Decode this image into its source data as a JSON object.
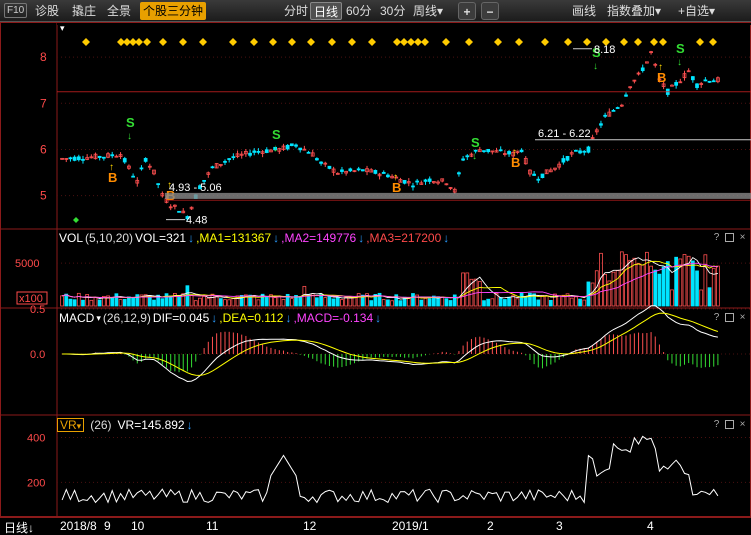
{
  "toolbar": {
    "f10": "F10",
    "diagnose": "诊股",
    "pick": "撬庄",
    "panorama": "全景",
    "minute3": "个股三分钟",
    "intraday": "分时",
    "daily": "日线",
    "m60": "60分",
    "m30": "30分",
    "weekly": "周线",
    "weekly_arrow": "▾",
    "zoom_in": "+",
    "zoom_out": "−",
    "draw": "画线",
    "index_overlay": "指数叠加",
    "index_arrow": "▾",
    "add_watch": "+自选",
    "add_arrow": "▾"
  },
  "corner_menu": "▾",
  "main_chart": {
    "y_ticks": [
      "8",
      "7",
      "6",
      "5"
    ],
    "annotations": {
      "high": "8.18",
      "range1": "6.21 - 6.22",
      "range2": "4.93 - 5.06",
      "low": "4.48"
    },
    "signal_labels": {
      "buy": "B",
      "sell": "S"
    }
  },
  "vol_panel": {
    "name": "VOL",
    "params": "(5,10,20)",
    "vol": "VOL=321",
    "ma1": ",MA1=131367",
    "ma2": ",MA2=149776",
    "ma3": ",MA3=217200",
    "y_tick": "5000",
    "unit": "x100"
  },
  "macd_panel": {
    "name": "MACD",
    "params": "(26,12,9)",
    "dif": "DIF=0.045",
    "dea": ",DEA=0.112",
    "macd": ",MACD=-0.134",
    "y_ticks": [
      "0.5",
      "0.0"
    ]
  },
  "vr_panel": {
    "name": "VR",
    "params": "(26)",
    "vr": "VR=145.892",
    "y_ticks": [
      "400",
      "200"
    ]
  },
  "panel_controls": {
    "help": "?",
    "restore": "□",
    "close": "×"
  },
  "x_axis": {
    "period": "日线",
    "labels": [
      "2018/8",
      "9",
      "10",
      "11",
      "12",
      "2019/1",
      "2",
      "3",
      "4"
    ]
  },
  "colors": {
    "up": "#ff5050",
    "down": "#00e5ff",
    "ma1": "#ffffff",
    "ma2": "#ffff00",
    "ma3": "#ff44ff",
    "buy": "#ff8c00",
    "sell": "#33dd33",
    "grid": "#8b1a1a",
    "axis_text": "#ff4a4a"
  }
}
